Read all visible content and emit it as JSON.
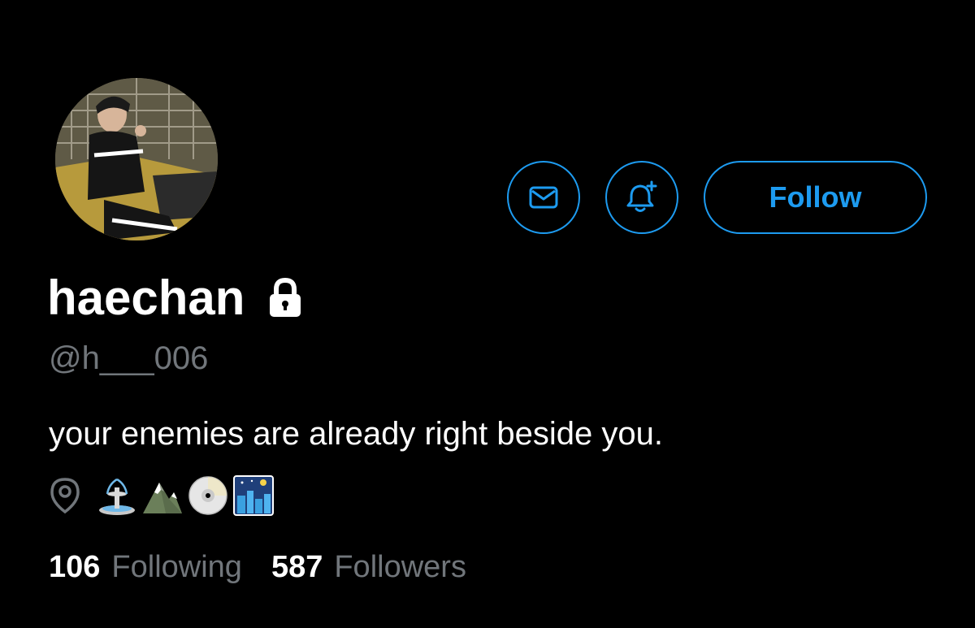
{
  "profile": {
    "display_name": "haechan",
    "handle": "@h___006",
    "bio": "your enemies are already right beside you.",
    "protected": true,
    "location_emojis": [
      "fountain",
      "snow-capped-mountain",
      "dvd",
      "night-with-stars"
    ]
  },
  "actions": {
    "message_icon": "envelope-icon",
    "notify_icon": "bell-plus-icon",
    "follow_label": "Follow"
  },
  "stats": {
    "following_count": "106",
    "following_label": "Following",
    "followers_count": "587",
    "followers_label": "Followers"
  },
  "colors": {
    "background": "#000000",
    "accent": "#1d9bf0",
    "secondary_text": "#71767b",
    "primary_text": "#ffffff"
  }
}
